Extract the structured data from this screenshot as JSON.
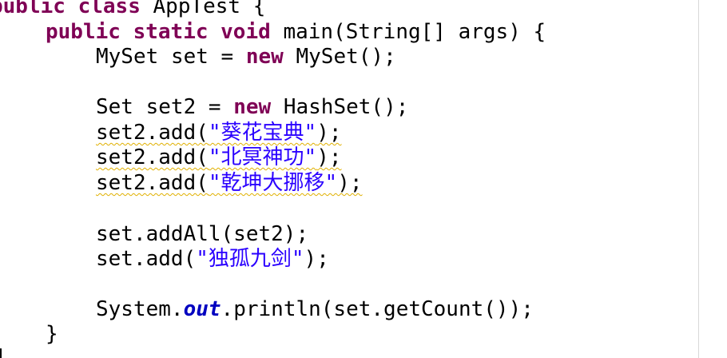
{
  "editor": {
    "lines": [
      {
        "kw1": "public",
        "kw2": "class",
        "text": "AppTest {"
      },
      {
        "kw1": "public",
        "kw2": "static",
        "kw3": "void",
        "text": "main(String[] args) {"
      },
      {
        "type": "MySet",
        "var": "set",
        "op": " = ",
        "kw": "new",
        "text": "MySet();"
      },
      {
        "type": "Set",
        "var": "set2",
        "op": " = ",
        "kw": "new",
        "text": "HashSet();"
      },
      {
        "call": "set2.add(",
        "str": "\"葵花宝典\"",
        "end": ");"
      },
      {
        "call": "set2.add(",
        "str": "\"北冥神功\"",
        "end": ");"
      },
      {
        "call": "set2.add(",
        "str": "\"乾坤大挪移\"",
        "end": ");"
      },
      {
        "text": "set.addAll(set2);"
      },
      {
        "call": "set.add(",
        "str": "\"独孤九剑\"",
        "end": ");"
      },
      {
        "pre": "System.",
        "field": "out",
        "post": ".println(set.getCount());"
      },
      {
        "text": "}"
      }
    ]
  }
}
